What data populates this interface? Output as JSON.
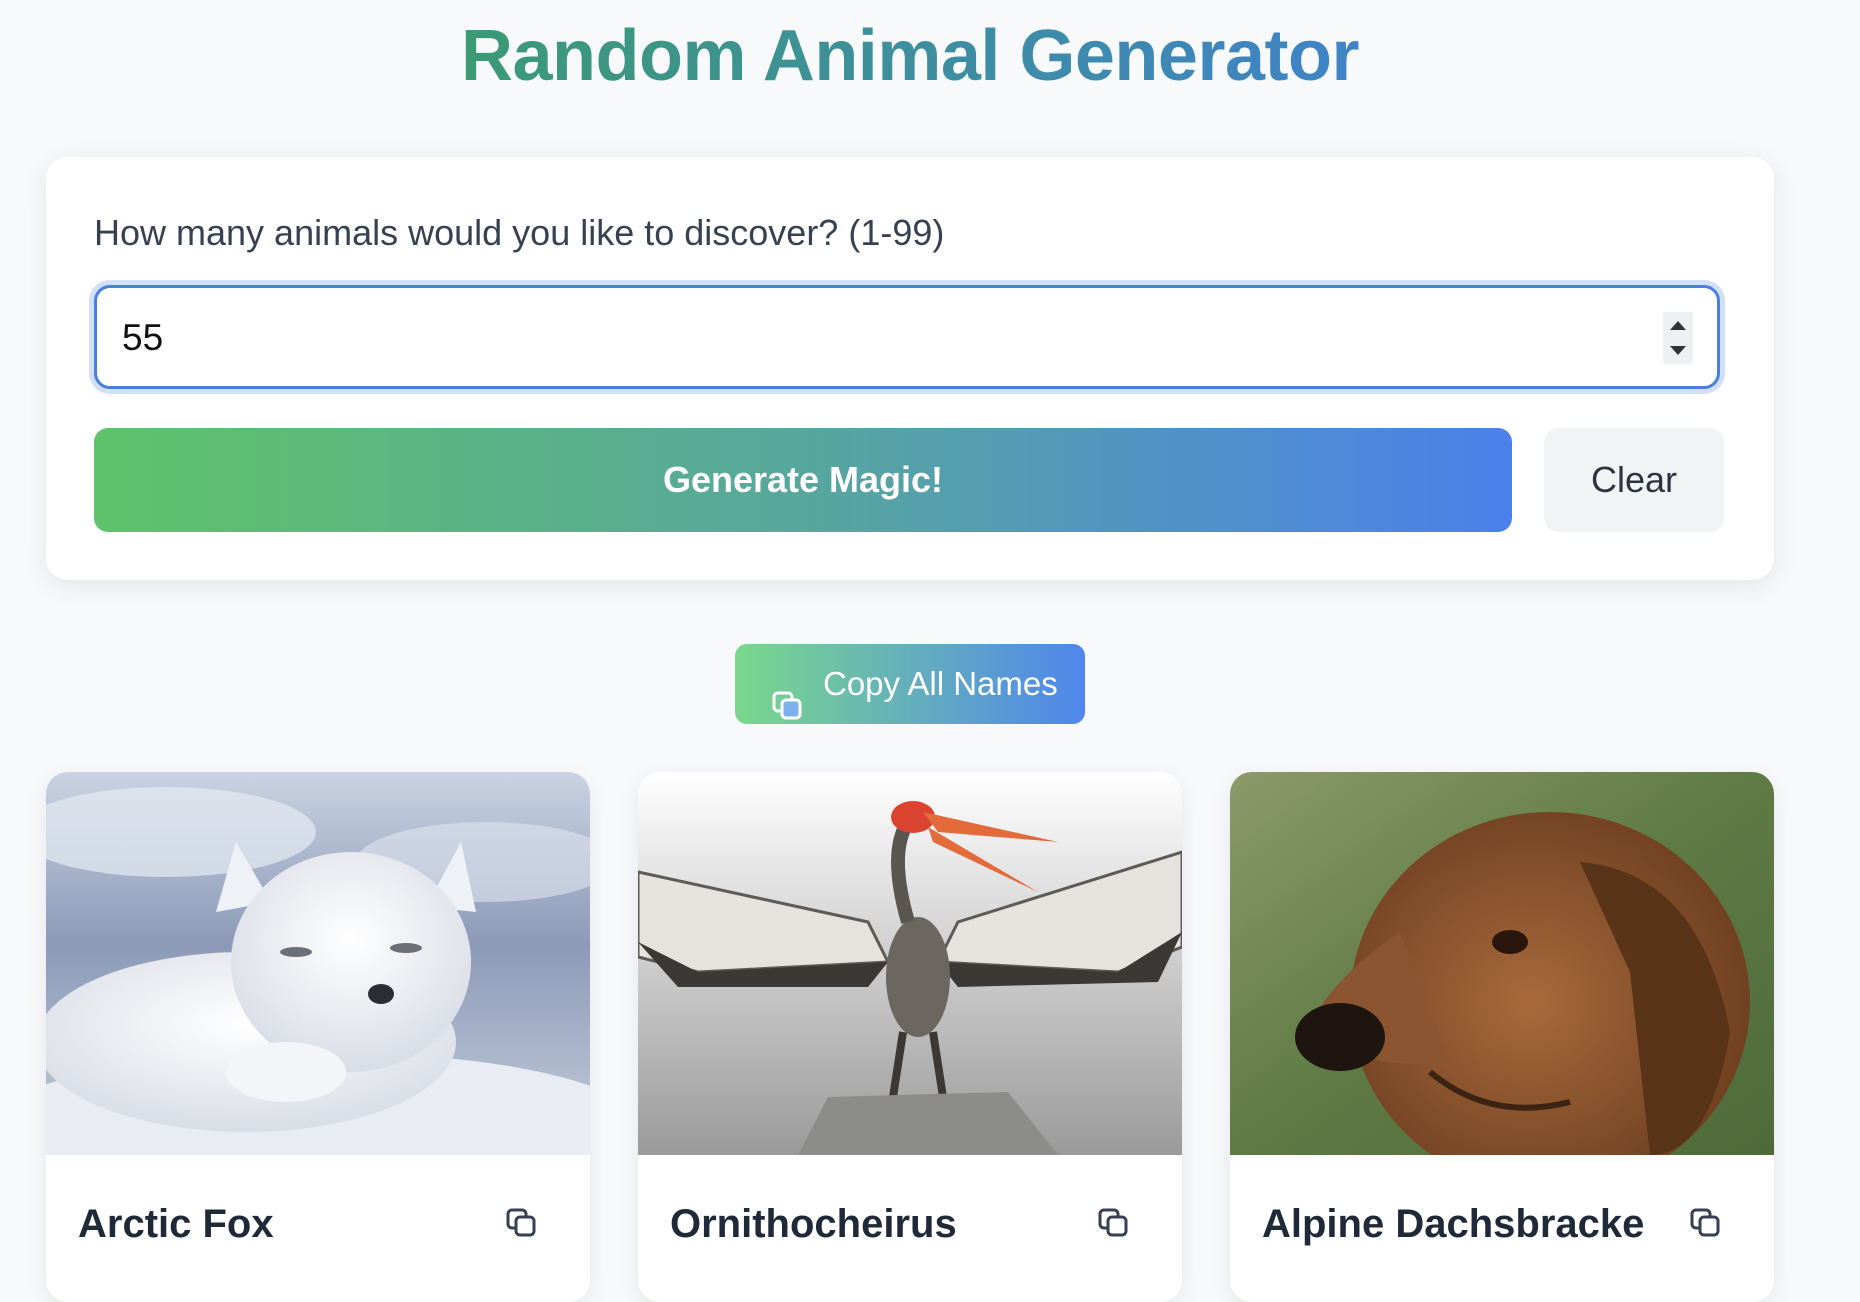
{
  "page": {
    "title": "Random Animal Generator"
  },
  "form": {
    "prompt_label": "How many animals would you like to discover? (1-99)",
    "count_value": "55",
    "generate_label": "Generate Magic!",
    "clear_label": "Clear"
  },
  "results": {
    "copy_all_label": "Copy All Names",
    "cards": [
      {
        "name": "Arctic Fox",
        "image_subject": "white arctic fox lying in snow"
      },
      {
        "name": "Ornithocheirus",
        "image_subject": "pterosaur with red crested beak, wings spread, on a rock"
      },
      {
        "name": "Alpine Dachsbracke",
        "image_subject": "brown hound dog head, green background"
      }
    ]
  },
  "colors": {
    "title_gradient_start": "#3c9a74",
    "title_gradient_end": "#3f83c8",
    "accent_green": "#5ec36a",
    "accent_blue": "#4b80ec",
    "input_focus": "#4a7fe0"
  },
  "icons": {
    "copy": "copy-icon",
    "stepper": "number-stepper"
  }
}
